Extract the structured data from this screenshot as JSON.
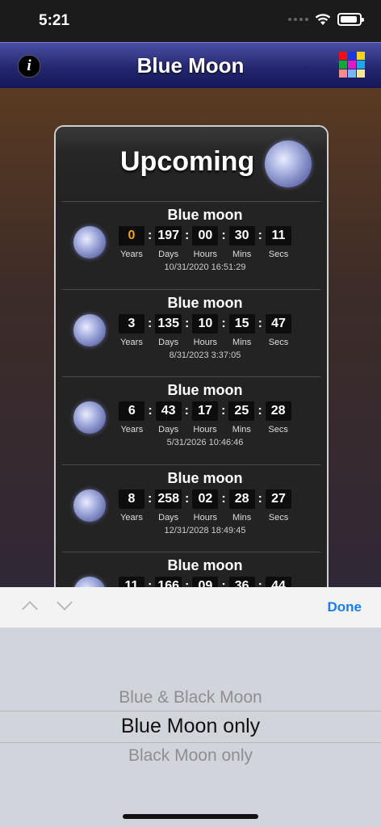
{
  "status_bar": {
    "time": "5:21"
  },
  "nav": {
    "title": "Blue Moon",
    "info_label": "i"
  },
  "grid_colors": [
    "#e8121e",
    "#1d35e0",
    "#f7d21a",
    "#19a33a",
    "#e617c8",
    "#1aa8ea",
    "#f38c8c",
    "#7ab6f5",
    "#f5e79a"
  ],
  "card": {
    "title": "Upcoming",
    "unit_labels": {
      "years": "Years",
      "days": "Days",
      "hours": "Hours",
      "mins": "Mins",
      "secs": "Secs"
    },
    "events": [
      {
        "name": "Blue moon",
        "years": "0",
        "days": "197",
        "hours": "00",
        "mins": "30",
        "secs": "11",
        "datetime": "10/31/2020  16:51:29"
      },
      {
        "name": "Blue moon",
        "years": "3",
        "days": "135",
        "hours": "10",
        "mins": "15",
        "secs": "47",
        "datetime": "8/31/2023  3:37:05"
      },
      {
        "name": "Blue moon",
        "years": "6",
        "days": "43",
        "hours": "17",
        "mins": "25",
        "secs": "28",
        "datetime": "5/31/2026  10:46:46"
      },
      {
        "name": "Blue moon",
        "years": "8",
        "days": "258",
        "hours": "02",
        "mins": "28",
        "secs": "27",
        "datetime": "12/31/2028  18:49:45"
      },
      {
        "name": "Blue moon",
        "years": "11",
        "days": "166",
        "hours": "09",
        "mins": "36",
        "secs": "44",
        "datetime": ""
      }
    ]
  },
  "toolbar": {
    "done_label": "Done"
  },
  "picker": {
    "options": [
      "Blue & Black Moon",
      "Blue Moon only",
      "Black Moon only"
    ],
    "selected": "Blue Moon only"
  }
}
